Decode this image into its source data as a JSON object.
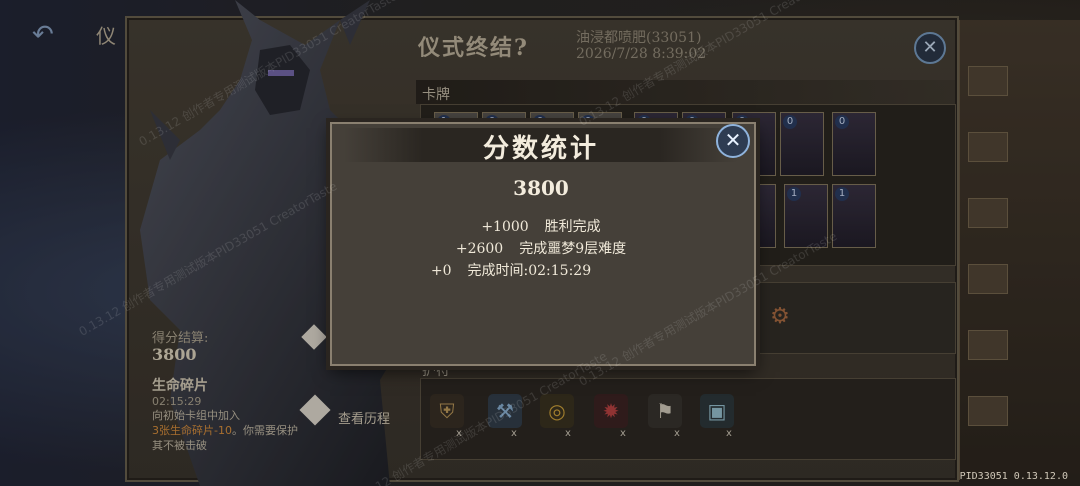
{
  "header": {
    "left_title": "仪",
    "dialog_title": "仪式终结?",
    "player_name": "油浸都喷肥(33051)",
    "timestamp": "2026/7/28 8:39:02"
  },
  "sections": {
    "cards_label": "卡牌",
    "relics_label": "护符"
  },
  "cards": [
    {
      "cost": "1"
    },
    {
      "cost": "0"
    },
    {
      "cost": "0"
    },
    {
      "cost": "0"
    },
    {
      "cost": "0"
    },
    {
      "cost": "0"
    },
    {
      "cost": "0"
    },
    {
      "cost": "0"
    },
    {
      "cost": "0"
    },
    {
      "cost": "1"
    },
    {
      "cost": "1"
    },
    {
      "cost": "1"
    }
  ],
  "left_panel": {
    "score_label": "得分结算:",
    "score_value": "3800",
    "shard_title": "生命碎片",
    "shard_time": "02:15:29",
    "shard_desc_1": "向初始卡组中加入",
    "shard_desc_hl": "3张生命碎片-10",
    "shard_desc_2": "。你需要保护其不被击破",
    "history_label": "查看历程"
  },
  "popup": {
    "title": "分数统计",
    "total": "3800",
    "lines": [
      {
        "points": "+1000",
        "desc": "胜利完成"
      },
      {
        "points": "+2600",
        "desc": "完成噩梦9层难度"
      },
      {
        "points": "+0",
        "desc": "完成时间:02:15:29"
      }
    ]
  },
  "relic_x": "x",
  "watermark": "0.13.12 创作者专用测试版本PID33051 CreatorTaste",
  "version": "PID33051  0.13.12.0",
  "icons": {
    "back": "back-arrow-icon",
    "close": "close-icon",
    "history": "history-icon"
  }
}
